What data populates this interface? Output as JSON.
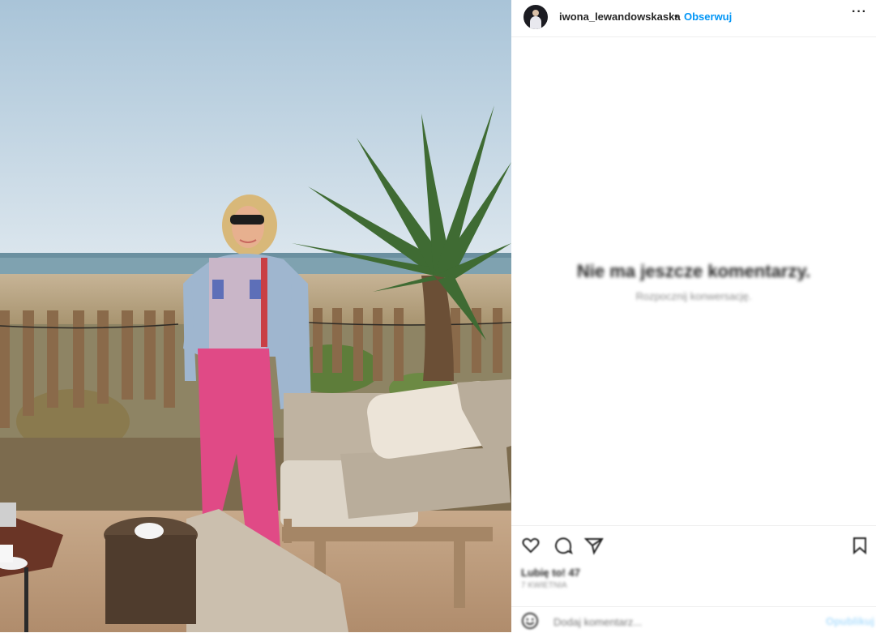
{
  "post": {
    "username": "iwona_lewandowskaska",
    "separator": "•",
    "follow_label": "Obserwuj",
    "more_label": "···"
  },
  "comments": {
    "empty_title": "Nie ma jeszcze komentarzy.",
    "empty_subtitle": "Rozpocznij konwersację."
  },
  "actions": {
    "icons": [
      "heart-icon",
      "comment-icon",
      "share-icon",
      "bookmark-icon"
    ],
    "likes": "Lubię to! 47",
    "date": "7 KWIETNIA"
  },
  "comment_box": {
    "placeholder": "Dodaj komentarz...",
    "publish_label": "Opublikuj",
    "emoji_icon": "emoji-icon"
  },
  "colors": {
    "follow": "#0095f6",
    "pants": "#e04a86",
    "sky": "#c9dcea"
  }
}
